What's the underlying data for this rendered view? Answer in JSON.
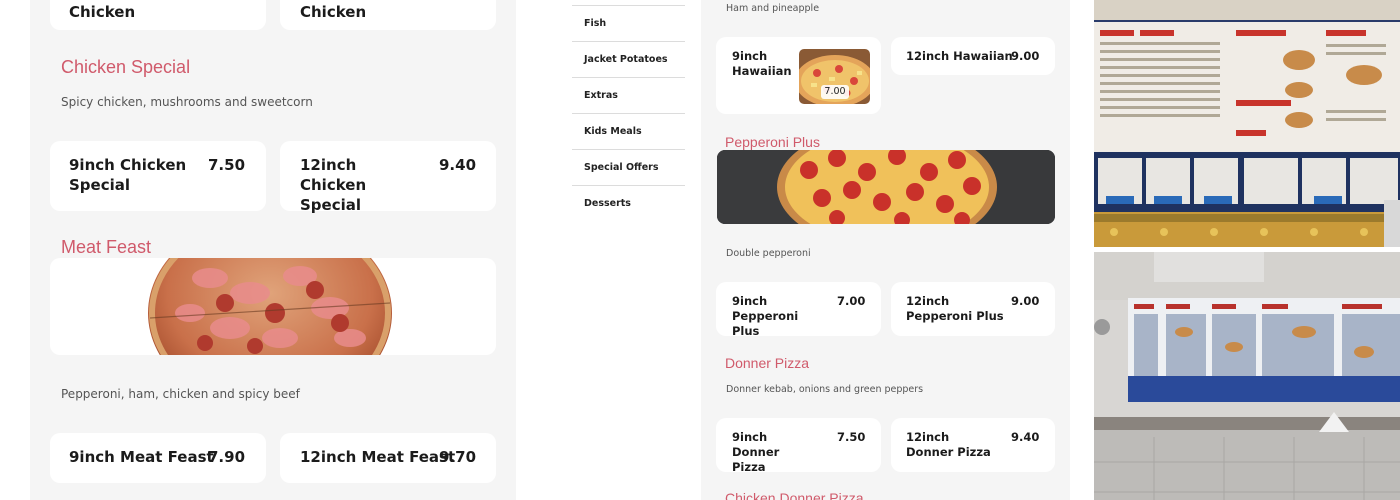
{
  "left_menu": {
    "top_cards": [
      {
        "name": "Chicken"
      },
      {
        "name": "Chicken"
      }
    ],
    "chicken_special": {
      "title": "Chicken Special",
      "description": "Spicy chicken, mushrooms and sweetcorn",
      "items": [
        {
          "name": "9inch Chicken Special",
          "price": "7.50"
        },
        {
          "name": "12inch Chicken Special",
          "price": "9.40"
        }
      ]
    },
    "meat_feast": {
      "title": "Meat Feast",
      "description": "Pepperoni, ham, chicken and spicy beef",
      "items": [
        {
          "name": "9inch Meat Feast",
          "price": "7.90"
        },
        {
          "name": "12inch Meat Feast",
          "price": "9.70"
        }
      ]
    }
  },
  "categories": [
    "Fish",
    "Jacket Potatoes",
    "Extras",
    "Kids Meals",
    "Special Offers",
    "Desserts"
  ],
  "right_menu": {
    "hawaiian": {
      "description": "Ham and pineapple",
      "items": [
        {
          "name": "9inch Hawaiian",
          "image_price": "7.00"
        },
        {
          "name": "12inch Hawaiian",
          "price": "9.00"
        }
      ]
    },
    "pepperoni_plus": {
      "title": "Pepperoni Plus",
      "description": "Double pepperoni",
      "items": [
        {
          "name": "9inch Pepperoni Plus",
          "price": "7.00"
        },
        {
          "name": "12inch Pepperoni Plus",
          "price": "9.00"
        }
      ]
    },
    "donner_pizza": {
      "title": "Donner Pizza",
      "description": "Donner kebab, onions and green peppers",
      "items": [
        {
          "name": "9inch Donner Pizza",
          "price": "7.50"
        },
        {
          "name": "12inch Donner Pizza",
          "price": "9.40"
        }
      ]
    },
    "chicken_donner_pizza": {
      "title": "Chicken Donner Pizza"
    }
  },
  "colors": {
    "accent": "#d05a6b",
    "panel_bg": "#f5f5f5",
    "card_bg": "#ffffff"
  }
}
